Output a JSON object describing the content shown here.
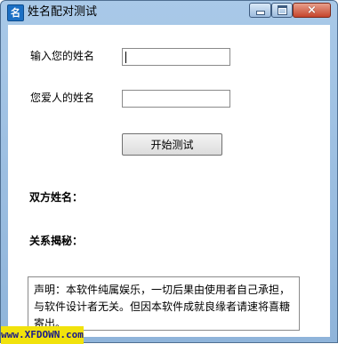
{
  "window": {
    "icon_text": "名",
    "title": "姓名配对测试",
    "controls": {
      "minimize": "minimize",
      "maximize": "maximize",
      "close": "×"
    }
  },
  "form": {
    "your_name_label": "输入您的姓名",
    "your_name_value": "",
    "lover_name_label": "您爱人的姓名",
    "lover_name_value": "",
    "start_button": "开始测试"
  },
  "results": {
    "both_names_label": "双方姓名：",
    "relation_label": "关系揭秘："
  },
  "notice": {
    "text": "声明：本软件纯属娱乐，一切后果由使用者自己承担，与软件设计者无关。但因本软件成就良缘者请速将喜糖寄出。"
  },
  "watermark": "www.XFDOWN.com",
  "colors": {
    "titlebar": "#9fc0e3",
    "close_button": "#c5442c",
    "watermark_bg": "#f1e20c"
  }
}
